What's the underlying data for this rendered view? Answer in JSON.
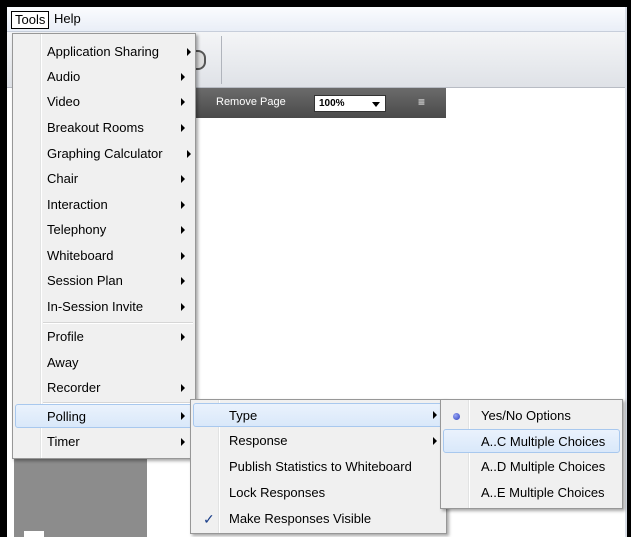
{
  "menubar": {
    "items": [
      {
        "label": "Tools",
        "active": true
      },
      {
        "label": "Help",
        "active": false
      }
    ]
  },
  "toolbar": {
    "remove_page_label": "Remove Page",
    "zoom_value": "100%",
    "list_icon": "≡"
  },
  "tools_menu": {
    "items": [
      {
        "label": "Application Sharing",
        "submenu": true
      },
      {
        "label": "Audio",
        "submenu": true
      },
      {
        "label": "Video",
        "submenu": true
      },
      {
        "label": "Breakout Rooms",
        "submenu": true
      },
      {
        "label": "Graphing Calculator",
        "submenu": true
      },
      {
        "label": "Chair",
        "submenu": true
      },
      {
        "label": "Interaction",
        "submenu": true
      },
      {
        "label": "Telephony",
        "submenu": true
      },
      {
        "label": "Whiteboard",
        "submenu": true
      },
      {
        "label": "Session Plan",
        "submenu": true
      },
      {
        "label": "In-Session Invite",
        "submenu": true
      },
      {
        "label": "Profile",
        "submenu": true
      },
      {
        "label": "Away",
        "submenu": false
      },
      {
        "label": "Recorder",
        "submenu": true
      },
      {
        "label": "Polling",
        "submenu": true,
        "highlighted": true
      },
      {
        "label": "Timer",
        "submenu": true
      }
    ]
  },
  "polling_menu": {
    "items": [
      {
        "label": "Type",
        "submenu": true,
        "highlighted": true
      },
      {
        "label": "Response",
        "submenu": true
      },
      {
        "label": "Publish Statistics to Whiteboard",
        "submenu": false
      },
      {
        "label": "Lock Responses",
        "submenu": false
      },
      {
        "label": "Make Responses Visible",
        "submenu": false,
        "checked": true,
        "check_glyph": "✓"
      }
    ]
  },
  "type_menu": {
    "items": [
      {
        "label": "Yes/No Options",
        "selected": true
      },
      {
        "label": "A..C Multiple Choices",
        "highlighted": true
      },
      {
        "label": "A..D Multiple Choices"
      },
      {
        "label": "A..E Multiple Choices"
      }
    ]
  },
  "colors": {
    "highlight_border": "#a8c8ee",
    "menu_bg": "#f0f0f0",
    "radio_color": "#2a3dbd"
  }
}
